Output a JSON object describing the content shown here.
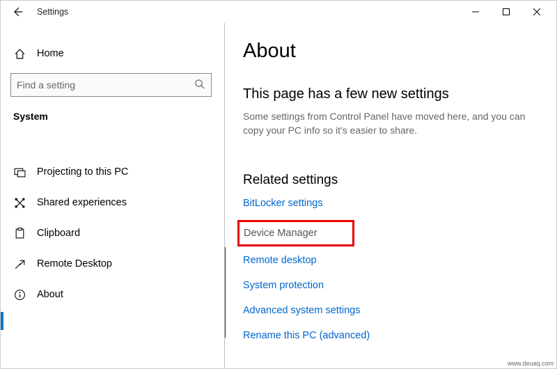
{
  "window": {
    "title": "Settings"
  },
  "sidebar": {
    "home": "Home",
    "search_placeholder": "Find a setting",
    "category": "System",
    "items": [
      {
        "label": "Projecting to this PC"
      },
      {
        "label": "Shared experiences"
      },
      {
        "label": "Clipboard"
      },
      {
        "label": "Remote Desktop"
      },
      {
        "label": "About"
      }
    ]
  },
  "content": {
    "title": "About",
    "subhead": "This page has a few new settings",
    "desc": "Some settings from Control Panel have moved here, and you can copy your PC info so it's easier to share.",
    "related_head": "Related settings",
    "links": [
      "BitLocker settings",
      "Device Manager",
      "Remote desktop",
      "System protection",
      "Advanced system settings",
      "Rename this PC (advanced)"
    ]
  },
  "watermark": "www.deuaq.com"
}
